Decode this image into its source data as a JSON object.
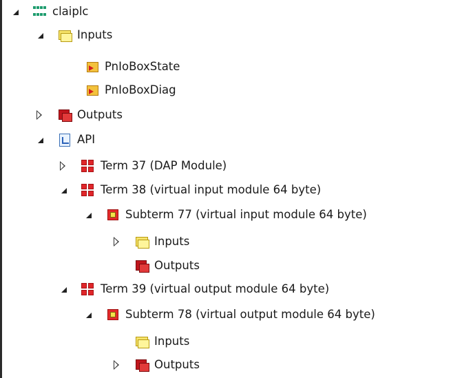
{
  "tree": {
    "nodes": [
      {
        "label": "claiplc",
        "icon": "plc-icon",
        "expander": "expanded",
        "level": 0
      },
      {
        "label": "Inputs",
        "icon": "inputs-folder-icon",
        "expander": "expanded",
        "level": 1
      },
      {
        "label": "PnIoBoxState",
        "icon": "input-variable-icon",
        "expander": "none",
        "level": 2
      },
      {
        "label": "PnIoBoxDiag",
        "icon": "input-variable-icon",
        "expander": "none",
        "level": 2
      },
      {
        "label": "Outputs",
        "icon": "outputs-folder-icon",
        "expander": "collapsed",
        "level": 1
      },
      {
        "label": "API",
        "icon": "api-icon",
        "expander": "expanded",
        "level": 1
      },
      {
        "label": "Term 37 (DAP Module)",
        "icon": "terminal-icon",
        "expander": "collapsed",
        "level": 2
      },
      {
        "label": "Term 38 (virtual input module 64 byte)",
        "icon": "terminal-icon",
        "expander": "expanded",
        "level": 2
      },
      {
        "label": "Subterm 77 (virtual input module 64 byte)",
        "icon": "subterminal-icon",
        "expander": "expanded",
        "level": 3
      },
      {
        "label": "Inputs",
        "icon": "inputs-folder-icon",
        "expander": "collapsed",
        "level": 4
      },
      {
        "label": "Outputs",
        "icon": "outputs-folder-icon",
        "expander": "none",
        "level": 4
      },
      {
        "label": "Term 39 (virtual output module 64 byte)",
        "icon": "terminal-icon",
        "expander": "expanded",
        "level": 2
      },
      {
        "label": "Subterm 78 (virtual output module 64 byte)",
        "icon": "subterminal-icon",
        "expander": "expanded",
        "level": 3
      },
      {
        "label": "Inputs",
        "icon": "inputs-folder-icon",
        "expander": "none",
        "level": 4
      },
      {
        "label": "Outputs",
        "icon": "outputs-folder-icon",
        "expander": "collapsed",
        "level": 4
      }
    ]
  }
}
